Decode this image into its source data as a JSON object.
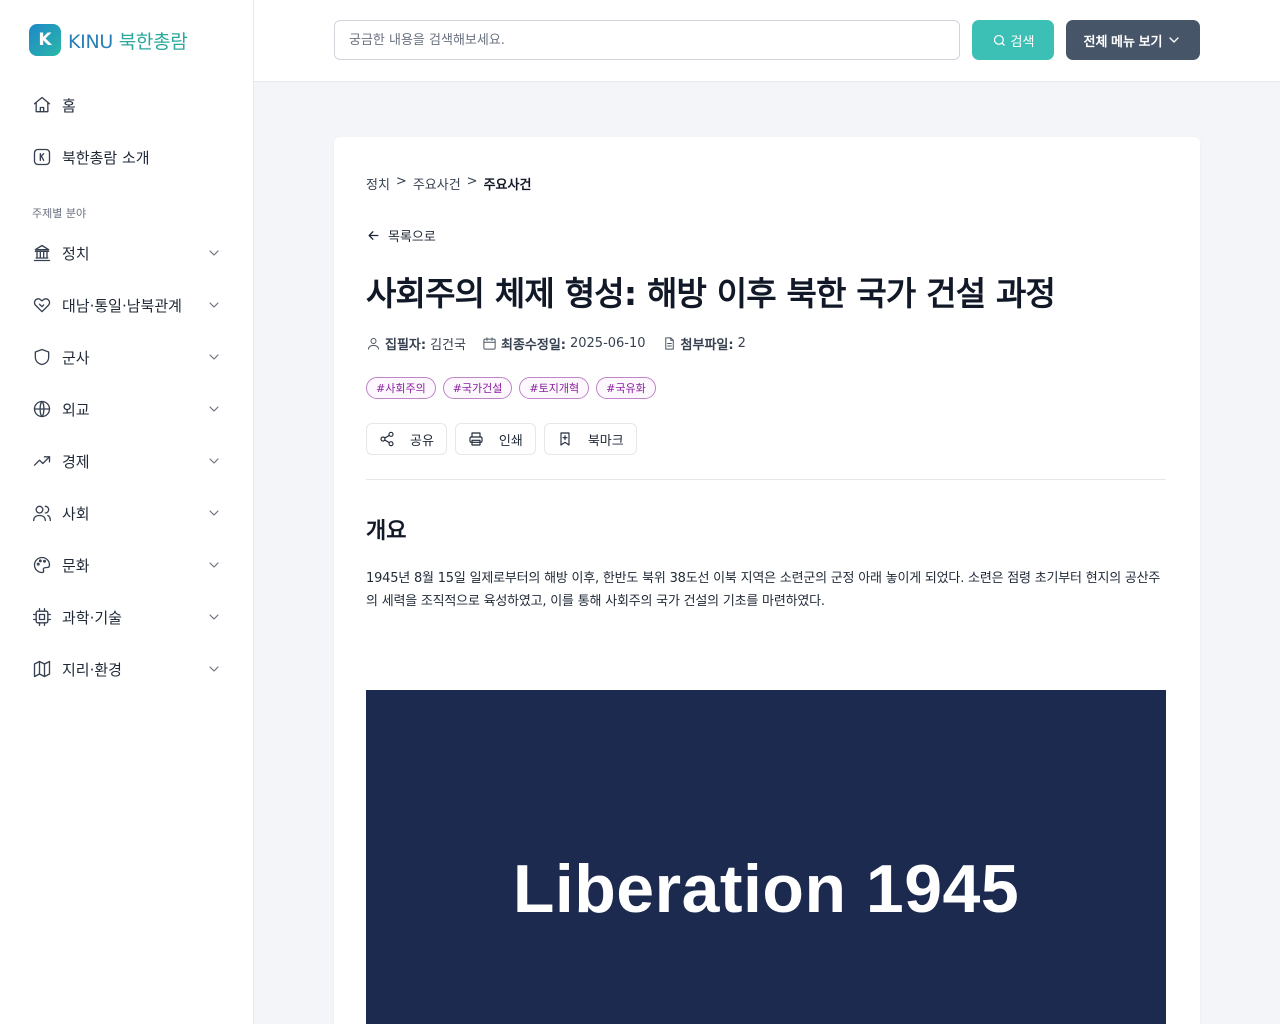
{
  "logo": {
    "mark": "K",
    "brand": "KINU",
    "name": "북한총람"
  },
  "sidebar": {
    "top_items": [
      {
        "label": "홈",
        "icon": "home-icon"
      },
      {
        "label": "북한총람 소개",
        "icon": "k-box-icon"
      }
    ],
    "section_label": "주제별 분야",
    "items": [
      {
        "label": "정치",
        "icon": "landmark-icon"
      },
      {
        "label": "대남·통일·남북관계",
        "icon": "handshake-icon"
      },
      {
        "label": "군사",
        "icon": "shield-icon"
      },
      {
        "label": "외교",
        "icon": "globe-icon"
      },
      {
        "label": "경제",
        "icon": "trending-up-icon"
      },
      {
        "label": "사회",
        "icon": "users-icon"
      },
      {
        "label": "문화",
        "icon": "palette-icon"
      },
      {
        "label": "과학·기술",
        "icon": "cpu-icon"
      },
      {
        "label": "지리·환경",
        "icon": "map-icon"
      }
    ]
  },
  "header": {
    "search_placeholder": "궁금한 내용을 검색해보세요.",
    "search_label": "검색",
    "menu_label": "전체 메뉴 보기"
  },
  "article": {
    "breadcrumb": [
      "정치",
      ">",
      "주요사건",
      ">",
      "주요사건"
    ],
    "back_label": "목록으로",
    "title": "사회주의 체제 형성: 해방 이후 북한 국가 건설 과정",
    "meta": {
      "author_label": "집필자:",
      "author": "김건국",
      "updated_label": "최종수정일:",
      "updated": "2025-06-10",
      "files_label": "첨부파일:",
      "files": "2"
    },
    "tags": [
      "#사회주의",
      "#국가건설",
      "#토지개혁",
      "#국유화"
    ],
    "actions": {
      "share": "공유",
      "print": "인쇄",
      "bookmark": "북마크"
    },
    "section_title": "개요",
    "paragraph": "1945년 8월 15일 일제로부터의 해방 이후, 한반도 북위 38도선 이북 지역은 소련군의 군정 아래 놓이게 되었다. 소련은 점령 초기부터 현지의 공산주의 세력을 조직적으로 육성하였고, 이를 통해 사회주의 국가 건설의 기초를 마련하였다.",
    "hero_text": "Liberation 1945"
  },
  "colors": {
    "accent": "#3cbfb4",
    "menu_button": "#475569",
    "tag": "#8b1fa0",
    "hero_bg": "#1b2a4e"
  }
}
